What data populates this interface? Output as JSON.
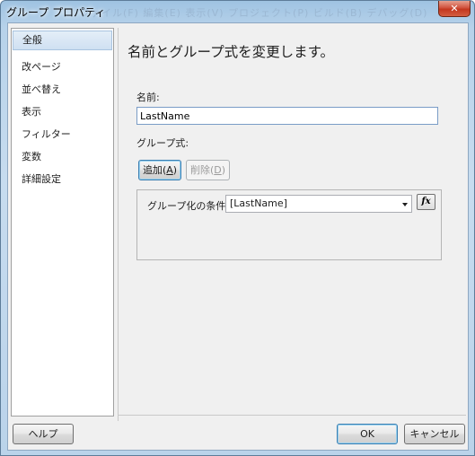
{
  "window": {
    "title": "グループ プロパティ",
    "ghost_menu": "ファイル(F)   編集(E)   表示(V)   プロジェクト(P)   ビルド(B)   デバッグ(D)",
    "close_glyph": "✕"
  },
  "sidebar": {
    "items": [
      {
        "label": "全般",
        "selected": true
      },
      {
        "label": "改ページ"
      },
      {
        "label": "並べ替え"
      },
      {
        "label": "表示"
      },
      {
        "label": "フィルター"
      },
      {
        "label": "変数"
      },
      {
        "label": "詳細設定"
      }
    ]
  },
  "main": {
    "heading": "名前とグループ式を変更します。",
    "name_label": "名前:",
    "name_value": "LastName",
    "group_expr_label": "グループ式:",
    "add_button": {
      "text": "追加",
      "mnemonic": "A"
    },
    "delete_button": {
      "text": "削除",
      "mnemonic": "D"
    },
    "condition_label": "グループ化の条件:",
    "condition_value": "[LastName]",
    "fx_label": "fx"
  },
  "footer": {
    "help": "ヘルプ",
    "ok": "OK",
    "cancel": "キャンセル"
  }
}
